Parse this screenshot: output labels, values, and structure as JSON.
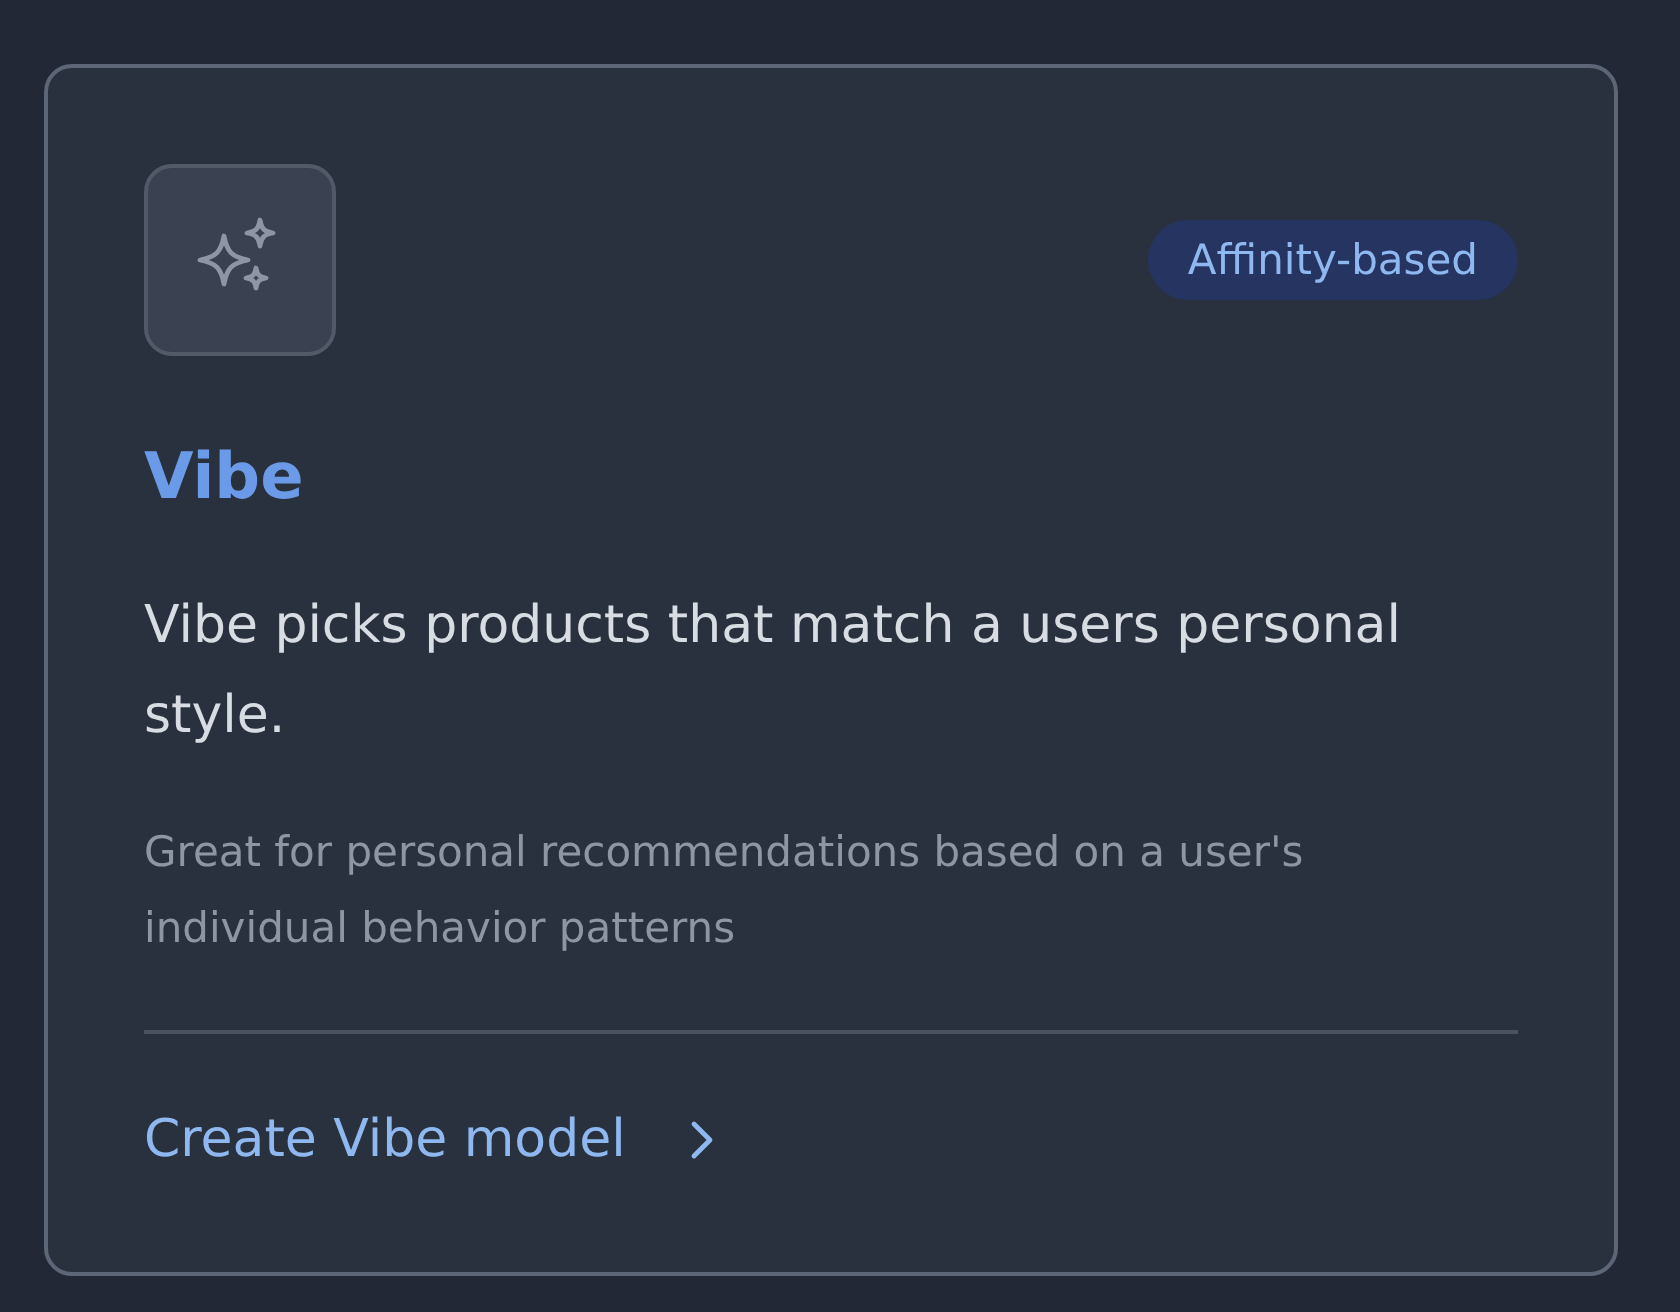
{
  "card": {
    "badge": "Affinity-based",
    "title": "Vibe",
    "description": "Vibe picks products that match a users personal style.",
    "note": "Great for personal recommendations based on a user's individual behavior patterns",
    "link": {
      "label": "Create Vibe model"
    }
  }
}
